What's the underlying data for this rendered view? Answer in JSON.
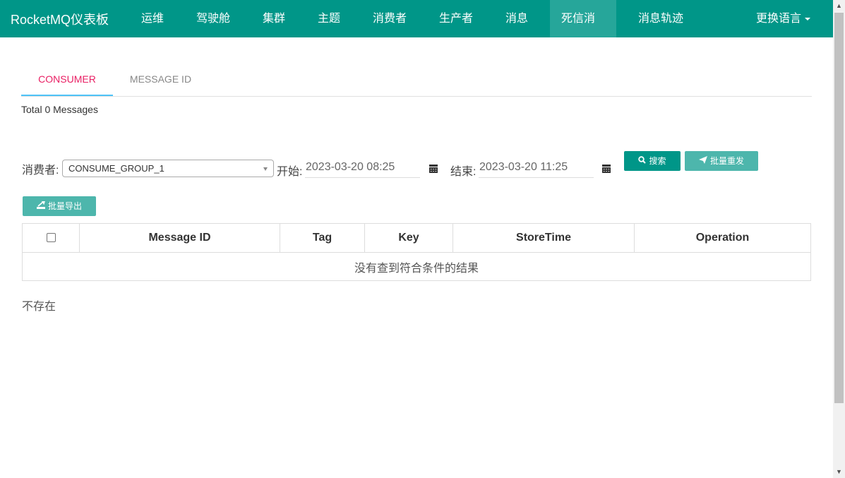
{
  "navbar": {
    "brand": "RocketMQ仪表板",
    "items": [
      {
        "label": "运维"
      },
      {
        "label": "驾驶舱"
      },
      {
        "label": "集群"
      },
      {
        "label": "主题"
      },
      {
        "label": "消费者"
      },
      {
        "label": "生产者"
      },
      {
        "label": "消息"
      },
      {
        "label": "死信消息",
        "active": true
      },
      {
        "label": "消息轨迹"
      }
    ],
    "language_label": "更换语言",
    "bg_color": "#009688"
  },
  "tabs": [
    {
      "label": "CONSUMER",
      "active": true
    },
    {
      "label": "MESSAGE ID",
      "active": false
    }
  ],
  "summary": {
    "total_text": "Total 0 Messages"
  },
  "filters": {
    "consumer_label": "消费者:",
    "consumer_value": "CONSUME_GROUP_1",
    "start_label": "开始:",
    "start_value": "2023-03-20 08:25",
    "end_label": "结束:",
    "end_value": "2023-03-20 11:25",
    "search_label": "搜索",
    "resend_label": "批量重发",
    "export_label": "批量导出"
  },
  "table": {
    "columns": [
      "Message ID",
      "Tag",
      "Key",
      "StoreTime",
      "Operation"
    ],
    "empty_text": "没有查到符合条件的结果"
  },
  "status": {
    "not_exist": "不存在"
  },
  "icons": {
    "search": "search-icon",
    "resend": "paper-plane-icon",
    "export": "export-icon",
    "calendar": "calendar-icon"
  },
  "colors": {
    "primary": "#009688",
    "light_primary": "#4db6ac",
    "tab_active_text": "#e91e63",
    "tab_indicator": "#4fc3f7"
  }
}
